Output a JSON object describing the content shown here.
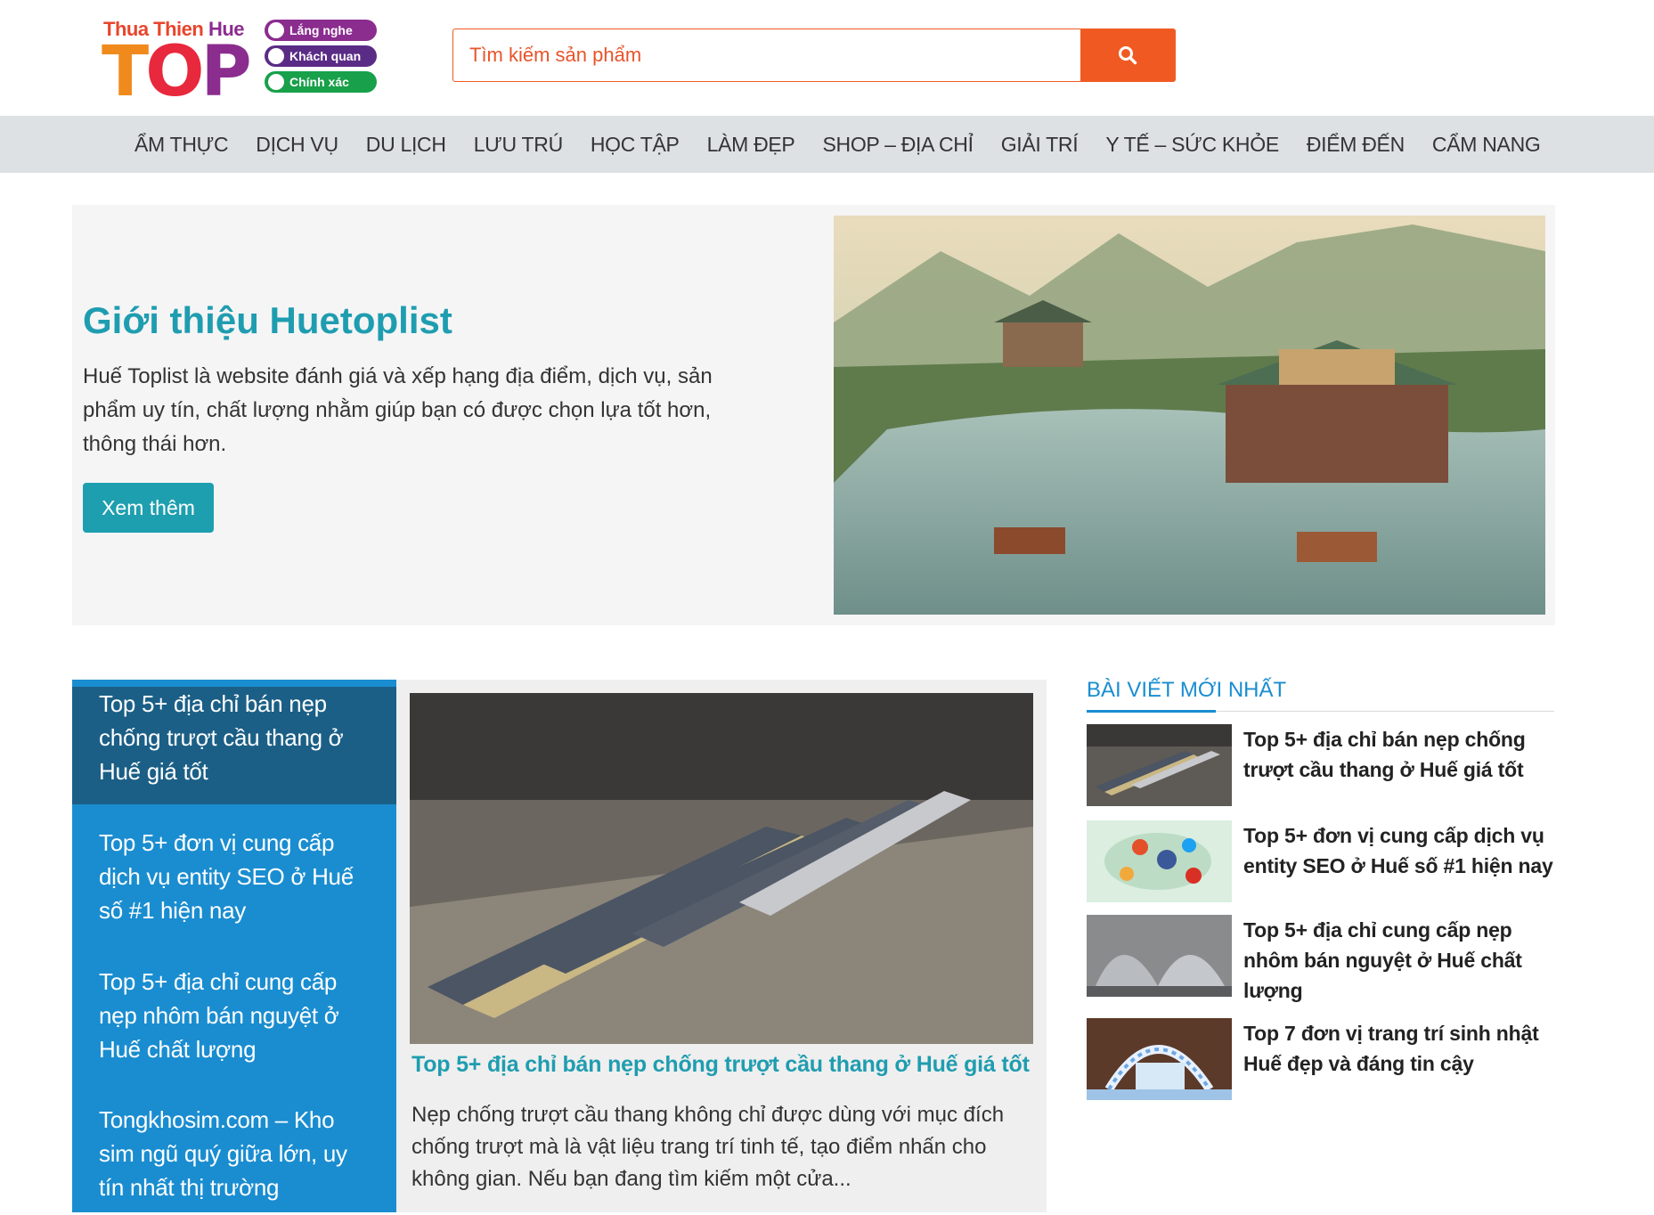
{
  "logo": {
    "brand_small_1": "Thua Thien",
    "brand_small_2": " Hue",
    "brand_big_t": "T",
    "brand_big_o": "O",
    "brand_big_p": "P",
    "tag1": "Lắng nghe",
    "tag2": "Khách quan",
    "tag3": "Chính xác"
  },
  "search": {
    "placeholder": "Tìm kiếm sản phẩm",
    "button_icon": "search-icon"
  },
  "nav": {
    "items": [
      "ẨM THỰC",
      "DỊCH VỤ",
      "DU LỊCH",
      "LƯU TRÚ",
      "HỌC TẬP",
      "LÀM ĐẸP",
      "SHOP – ĐỊA CHỈ",
      "GIẢI TRÍ",
      "Y TẾ – SỨC KHỎE",
      "ĐIỂM ĐẾN",
      "CẨM NANG"
    ]
  },
  "hero": {
    "title": "Giới thiệu Huetoplist",
    "description": "Huế Toplist là website đánh giá và xếp hạng địa điểm, dịch vụ, sản phẩm uy tín, chất lượng nhằm giúp bạn có được chọn lựa tốt hơn, thông thái hơn.",
    "button": "Xem thêm"
  },
  "featured": {
    "list": [
      "Top 5+ địa chỉ bán nẹp chống trượt cầu thang ở Huế giá tốt",
      "Top 5+ đơn vị cung cấp dịch vụ entity SEO ở Huế số #1 hiện nay",
      "Top 5+ địa chỉ cung cấp nẹp nhôm bán nguyệt ở Huế chất lượng",
      "Tongkhosim.com – Kho sim ngũ quý giữa lớn, uy tín nhất thị trường"
    ],
    "main_title": "Top 5+ địa chỉ bán nẹp chống trượt cầu thang ở Huế giá tốt",
    "main_excerpt": "Nẹp chống trượt cầu thang không chỉ được dùng với mục đích chống trượt mà là vật liệu trang trí tinh tế, tạo điểm nhấn cho không gian. Nếu bạn đang tìm kiếm một cửa..."
  },
  "sidebar": {
    "title": "BÀI VIẾT MỚI NHẤT",
    "posts": [
      "Top 5+ địa chỉ bán nẹp chống trượt cầu thang ở Huế giá tốt",
      "Top 5+ đơn vị cung cấp dịch vụ entity SEO ở Huế số #1 hiện nay",
      "Top 5+ địa chỉ cung cấp nẹp nhôm bán nguyệt ở Huế chất lượng",
      "Top 7 đơn vị trang trí sinh nhật Huế đẹp và đáng tin cậy"
    ]
  },
  "colors": {
    "accent_orange": "#f05a22",
    "teal": "#1f9db0",
    "blue": "#1a8dd0",
    "dark_blue": "#1b5f86"
  }
}
